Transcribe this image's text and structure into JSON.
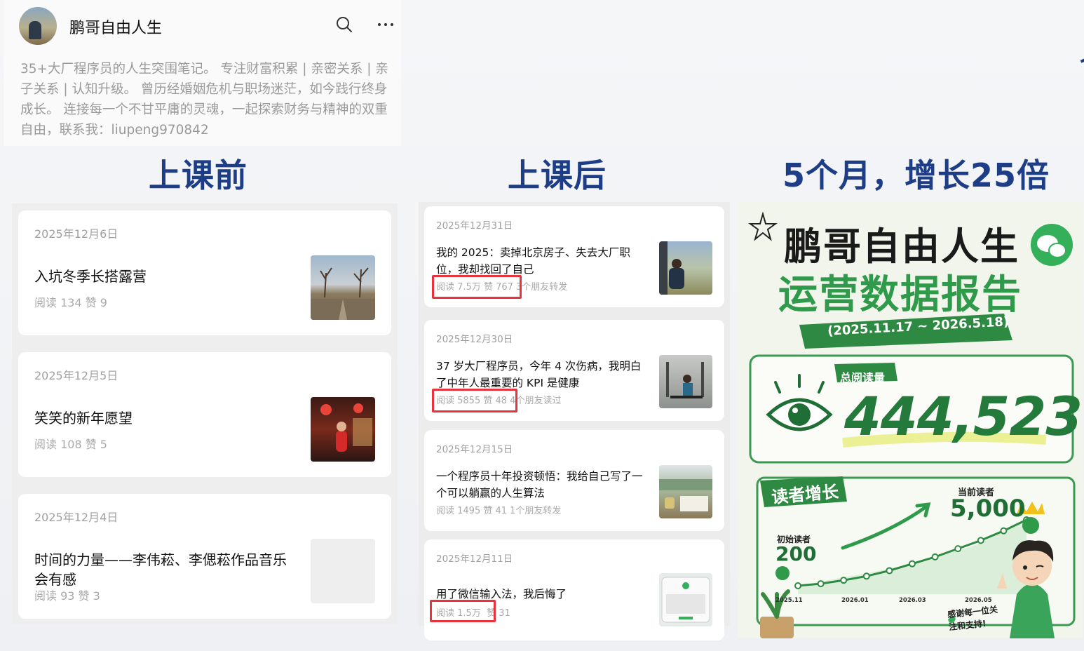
{
  "profile": {
    "name": "鹏哥自由人生",
    "description": "35+大厂程序员的人生突围笔记。 专注财富积累 | 亲密关系 | 亲子关系 | 认知升级。 曾历经婚姻危机与职场迷茫，如今践行终身成长。 连接每一个不甘平庸的灵魂，一起探索财务与精神的双重自由，联系我：liupeng970842",
    "icons": [
      "search-icon",
      "more-icon"
    ]
  },
  "headings": {
    "before": "上课前",
    "after": "上课后",
    "growth": "5个月，增长25倍"
  },
  "before_articles": [
    {
      "date": "2025年12月6日",
      "title": "入坑冬季长搭露营",
      "stats": "阅读 134   赞 9"
    },
    {
      "date": "2025年12月5日",
      "title": "笑笑的新年愿望",
      "stats": "阅读 108   赞 5"
    },
    {
      "date": "2025年12月4日",
      "title": "时间的力量——李伟菘、李偲菘作品音乐会有感",
      "stats": "阅读 93   赞 3"
    }
  ],
  "after_articles": [
    {
      "date": "2025年12月31日",
      "title": "我的 2025：卖掉北京房子、失去大厂职位，我却找回了自己",
      "stats_boxed": "阅读 7.5万   赞 767",
      "stats_rest": "3个朋友转发"
    },
    {
      "date": "2025年12月30日",
      "title": "37 岁大厂程序员，今年 4 次伤病，我明白了中年人最重要的 KPI 是健康",
      "stats_boxed": "阅读 5855   赞 48",
      "stats_rest": "4个朋友读过"
    },
    {
      "date": "2025年12月15日",
      "title": "一个程序员十年投资顿悟：我给自己写了一个可以躺赢的人生算法",
      "stats_boxed": "",
      "stats_rest": "阅读 1495   赞 41   1个朋友转发"
    },
    {
      "date": "2025年12月11日",
      "title": "用了微信输入法，我后悔了",
      "stats_boxed": "阅读 1.5万",
      "stats_rest": "赞 31"
    }
  ],
  "report": {
    "title_line1": "鹏哥自由人生",
    "title_line2": "运营数据报告",
    "period": "(2025.11.17 ~ 2026.5.18)",
    "total_reads_label": "总阅读量",
    "total_reads_value": "444,523",
    "growth_label": "读者增长",
    "start_label": "初始读者",
    "start_value": "200",
    "current_label": "当前读者",
    "current_value": "5,000",
    "thanks": "感谢每一位关注和支持!",
    "accent_color": "#2e9a4a",
    "chart_data": {
      "type": "line",
      "x": [
        "2025.11",
        "2026.01",
        "2026.03",
        "2026.05"
      ],
      "ticks": [
        "2025.11",
        "2026.01",
        "2026.03",
        "2026.05"
      ],
      "series": [
        {
          "values": [
            200,
            350,
            600,
            900,
            1300,
            1800,
            2300,
            2900,
            3500,
            4200,
            5000
          ]
        }
      ],
      "grid": false
    }
  }
}
